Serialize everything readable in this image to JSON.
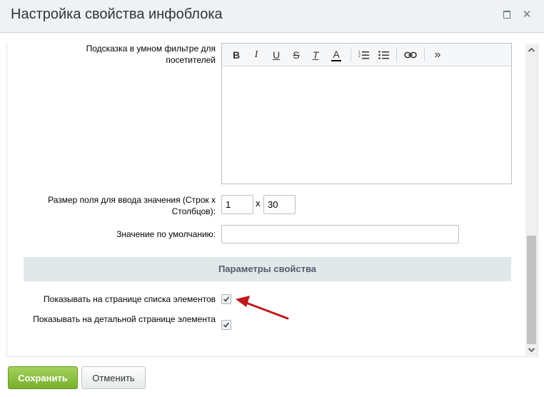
{
  "dialog": {
    "title": "Настройка свойства инфоблока",
    "maximize_icon": "maximize-icon",
    "close_icon": "close-icon",
    "close_glyph": "✕"
  },
  "form": {
    "hint_label": "Подсказка в умном фильтре для посетителей",
    "toolbar": {
      "bold": "B",
      "italic": "I",
      "underline": "U",
      "strike": "S",
      "clear_format": "T",
      "font_color": "A",
      "more": "»",
      "icons": [
        "bold-icon",
        "italic-icon",
        "underline-icon",
        "strikethrough-icon",
        "remove-format-icon",
        "font-color-icon",
        "ordered-list-icon",
        "unordered-list-icon",
        "link-icon",
        "more-icon"
      ]
    },
    "size_label": "Размер поля для ввода значения (Строк x Столбцов):",
    "rows_value": "1",
    "size_separator": "x",
    "cols_value": "30",
    "default_label": "Значение по умолчанию:",
    "default_value": ""
  },
  "params": {
    "section_title": "Параметры свойства",
    "show_in_list_label": "Показывать на странице списка элементов",
    "show_in_list_checked": true,
    "show_in_detail_label": "Показывать на детальной странице элемента",
    "show_in_detail_checked": true
  },
  "buttons": {
    "save": "Сохранить",
    "cancel": "Отменить"
  },
  "colors": {
    "accent_green": "#8bc53f",
    "annotation_arrow": "#c0191f"
  }
}
